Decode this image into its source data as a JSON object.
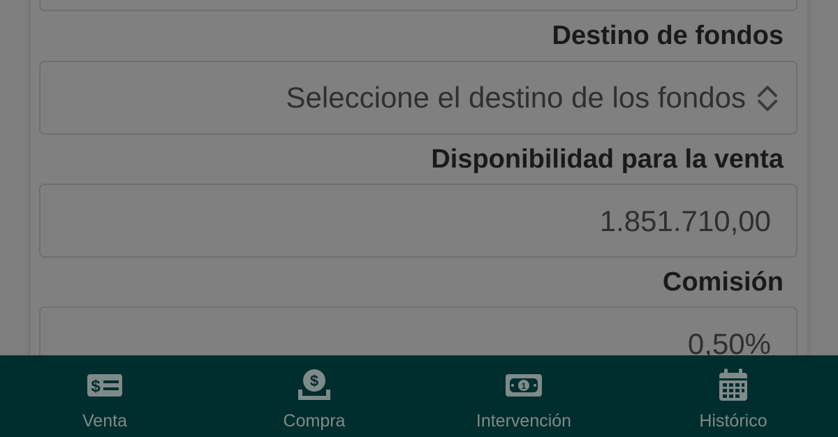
{
  "form": {
    "destino_label": "Destino de fondos",
    "destino_placeholder": "Seleccione el destino de los fondos",
    "disponibilidad_label": "Disponibilidad para la venta",
    "disponibilidad_value": "1.851.710,00",
    "comision_label": "Comisión",
    "comision_value": "0,50%"
  },
  "nav": {
    "items": [
      {
        "label": "Venta",
        "icon": "money-bill-icon"
      },
      {
        "label": "Compra",
        "icon": "hand-coin-icon"
      },
      {
        "label": "Intervención",
        "icon": "cash-icon"
      },
      {
        "label": "Histórico",
        "icon": "calendar-icon"
      }
    ]
  },
  "colors": {
    "nav_background": "#002d2d",
    "overlay_gray": "#808080",
    "nav_icon": "#7f8a8a",
    "label_text": "#1a1a1a"
  }
}
